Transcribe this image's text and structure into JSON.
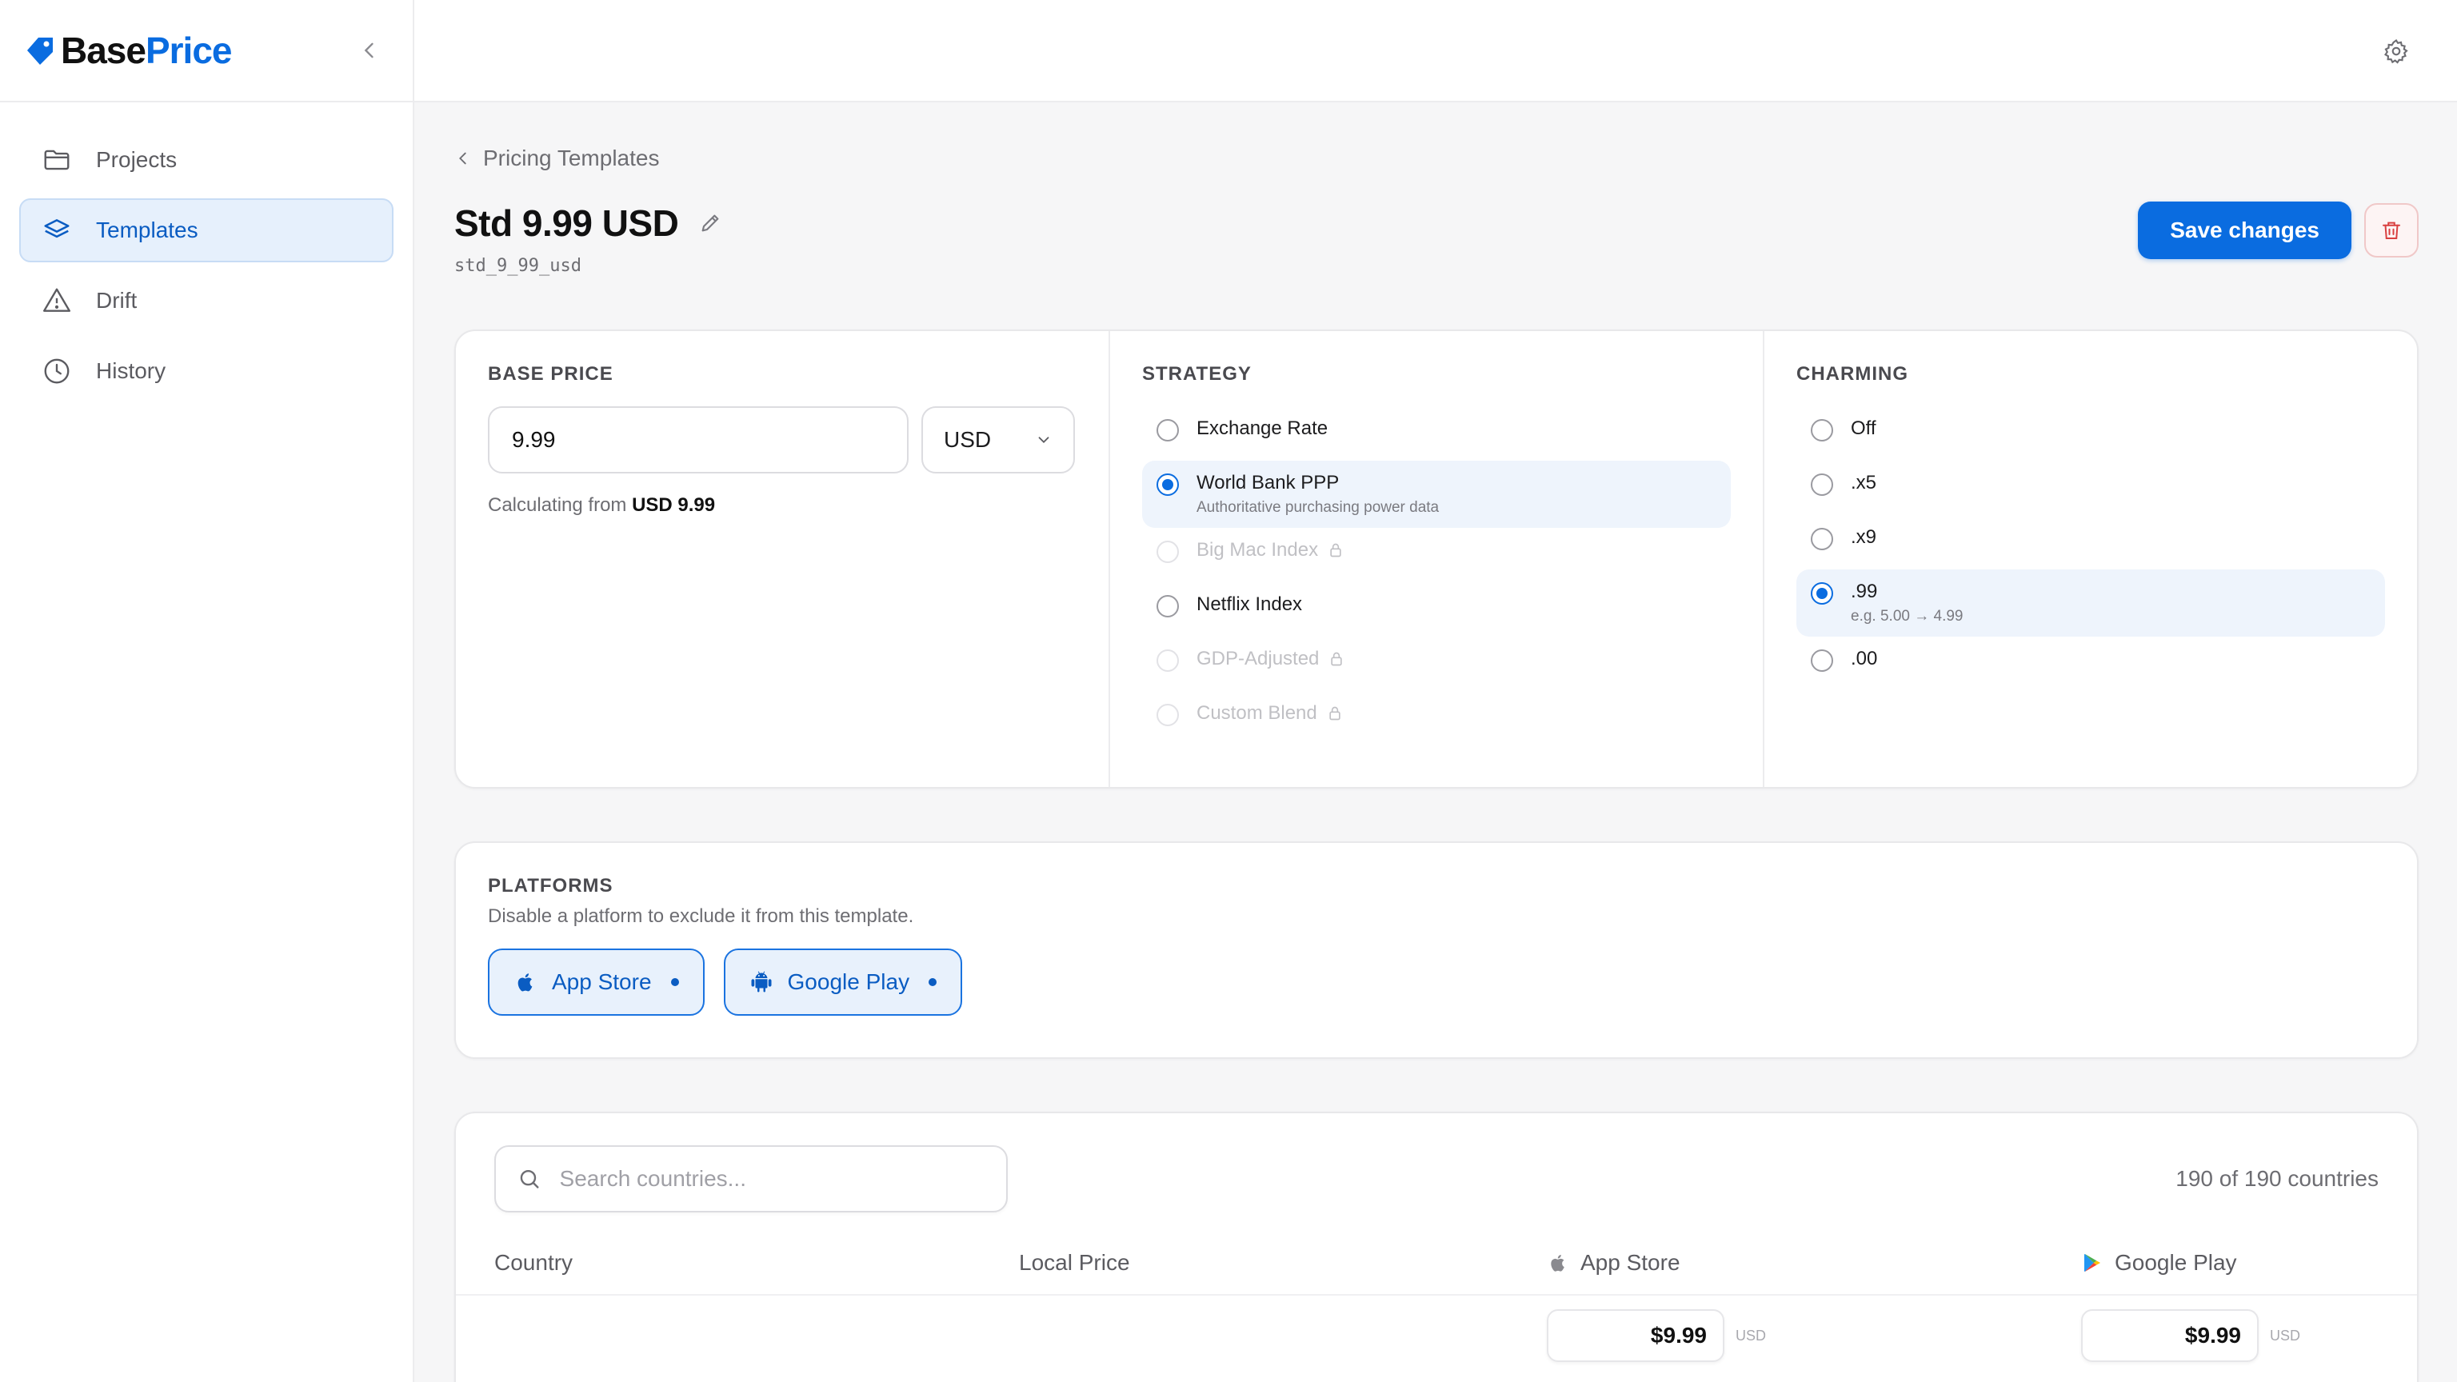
{
  "brand": {
    "name_part1": "Base",
    "name_part2": "Price",
    "accent_color": "#0a6ce0"
  },
  "sidebar": {
    "items": [
      {
        "label": "Projects",
        "icon": "folder-icon"
      },
      {
        "label": "Templates",
        "icon": "layers-icon",
        "active": true
      },
      {
        "label": "Drift",
        "icon": "warning-icon"
      },
      {
        "label": "History",
        "icon": "clock-icon"
      }
    ]
  },
  "breadcrumb": {
    "label": "Pricing Templates"
  },
  "template": {
    "title": "Std 9.99 USD",
    "slug": "std_9_99_usd"
  },
  "actions": {
    "save_label": "Save changes"
  },
  "base_price": {
    "label": "BASE PRICE",
    "value": "9.99",
    "currency": "USD",
    "note_prefix": "Calculating from",
    "note_value": "USD 9.99"
  },
  "strategy": {
    "label": "STRATEGY",
    "options": [
      {
        "label": "Exchange Rate",
        "sub": ""
      },
      {
        "label": "World Bank PPP",
        "sub": "Authoritative purchasing power data"
      },
      {
        "label": "Big Mac Index",
        "sub": ""
      },
      {
        "label": "Netflix Index",
        "sub": ""
      },
      {
        "label": "GDP-Adjusted",
        "sub": ""
      },
      {
        "label": "Custom Blend",
        "sub": ""
      }
    ]
  },
  "charming": {
    "label": "CHARMING",
    "options": [
      {
        "label": "Off",
        "sub": ""
      },
      {
        "label": ".x5",
        "sub": ""
      },
      {
        "label": ".x9",
        "sub": ""
      },
      {
        "label": ".99",
        "sub": "e.g. 5.00 → 4.99"
      },
      {
        "label": ".00",
        "sub": ""
      }
    ]
  },
  "platforms": {
    "label": "PLATFORMS",
    "description": "Disable a platform to exclude it from this template.",
    "items": [
      {
        "label": "App Store"
      },
      {
        "label": "Google Play"
      }
    ]
  },
  "countries_table": {
    "search_placeholder": "Search countries...",
    "count": "190 of 190 countries",
    "headers": {
      "country": "Country",
      "local_price": "Local Price",
      "app_store": "App Store",
      "google_play": "Google Play"
    },
    "rows": [
      {
        "app_store_price": "$9.99",
        "app_store_currency": "USD",
        "google_play_price": "$9.99",
        "google_play_currency": "USD"
      }
    ]
  }
}
